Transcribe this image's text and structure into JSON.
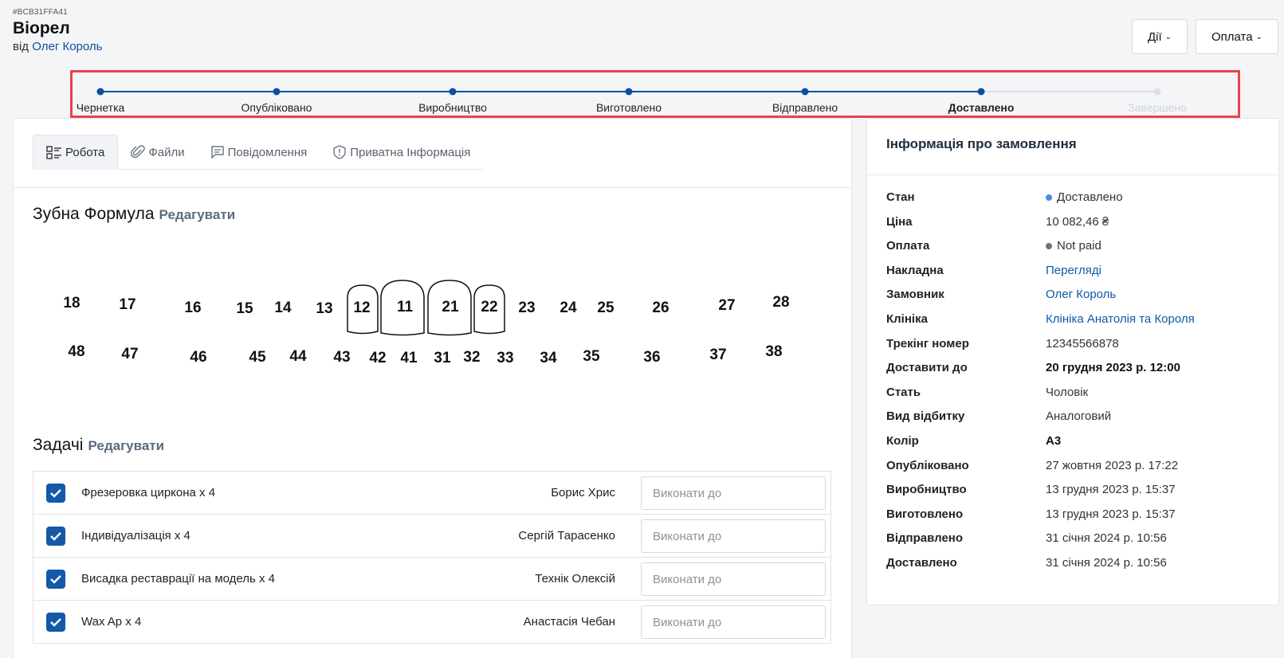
{
  "header": {
    "order_id": "#BCB31FFA41",
    "title": "Віорел",
    "by_prefix": "від",
    "by_name": "Олег Король",
    "actions_label": "Дії",
    "payment_label": "Оплата"
  },
  "stepper": {
    "steps": [
      {
        "label": "Чернетка",
        "state": "done"
      },
      {
        "label": "Опубліковано",
        "state": "done"
      },
      {
        "label": "Виробництво",
        "state": "done"
      },
      {
        "label": "Виготовлено",
        "state": "done"
      },
      {
        "label": "Відправлено",
        "state": "done"
      },
      {
        "label": "Доставлено",
        "state": "current"
      },
      {
        "label": "Завершено",
        "state": "pending"
      }
    ],
    "colors": {
      "active": "#0d4f9c",
      "pending": "#dde1e6"
    }
  },
  "tabs": [
    {
      "label": "Робота",
      "icon": "list-icon",
      "active": true
    },
    {
      "label": "Файли",
      "icon": "paperclip-icon",
      "active": false
    },
    {
      "label": "Повідомлення",
      "icon": "message-icon",
      "active": false
    },
    {
      "label": "Приватна Інформація",
      "icon": "shield-icon",
      "active": false
    }
  ],
  "formula": {
    "title": "Зубна Формула",
    "edit_label": "Редагувати",
    "upper_teeth": [
      "18",
      "17",
      "16",
      "15",
      "14",
      "13",
      "12",
      "11",
      "21",
      "22",
      "23",
      "24",
      "25",
      "26",
      "27",
      "28"
    ],
    "lower_teeth": [
      "48",
      "47",
      "46",
      "45",
      "44",
      "43",
      "42",
      "41",
      "31",
      "32",
      "33",
      "34",
      "35",
      "36",
      "37",
      "38"
    ],
    "selected_teeth": [
      "12",
      "11",
      "21",
      "22"
    ]
  },
  "tasks": {
    "title": "Задачі",
    "edit_label": "Редагувати",
    "due_placeholder": "Виконати до",
    "rows": [
      {
        "name": "Фрезеровка циркона x 4",
        "person": "Борис Хрис",
        "done": true
      },
      {
        "name": "Індивідуалізація x 4",
        "person": "Сергій Тарасенко",
        "done": true
      },
      {
        "name": "Висадка реставрації на модель x 4",
        "person": "Технік Олексій",
        "done": true
      },
      {
        "name": "Wax Ap x 4",
        "person": "Анастасія Чебан",
        "done": true
      }
    ]
  },
  "info": {
    "title": "Інформація про замовлення",
    "rows": [
      {
        "key": "Стан",
        "value": "Доставлено",
        "dot": "#4a90d9"
      },
      {
        "key": "Ціна",
        "value": "10 082,46 ₴"
      },
      {
        "key": "Оплата",
        "value": "Not paid",
        "dot": "#6c7480"
      },
      {
        "key": "Накладна",
        "value": "Переглядi",
        "link": true
      },
      {
        "key": "Замовник",
        "value": "Олег Король",
        "link": true
      },
      {
        "key": "Клініка",
        "value": "Клініка Анатолія та Короля",
        "link": true
      },
      {
        "key": "Трекінг номер",
        "value": "12345566878"
      },
      {
        "key": "Доставити до",
        "value": "20 грудня 2023 р. 12:00",
        "bold": true
      },
      {
        "key": "Стать",
        "value": "Чоловік"
      },
      {
        "key": "Вид відбитку",
        "value": "Аналоговий"
      },
      {
        "key": "Колір",
        "value": "A3",
        "bold": true
      },
      {
        "key": "Опубліковано",
        "value": "27 жовтня 2023 р. 17:22"
      },
      {
        "key": "Виробництво",
        "value": "13 грудня 2023 р. 15:37"
      },
      {
        "key": "Виготовлено",
        "value": "13 грудня 2023 р. 15:37"
      },
      {
        "key": "Відправлено",
        "value": "31 січня 2024 р. 10:56"
      },
      {
        "key": "Доставлено",
        "value": "31 січня 2024 р. 10:56"
      }
    ]
  }
}
